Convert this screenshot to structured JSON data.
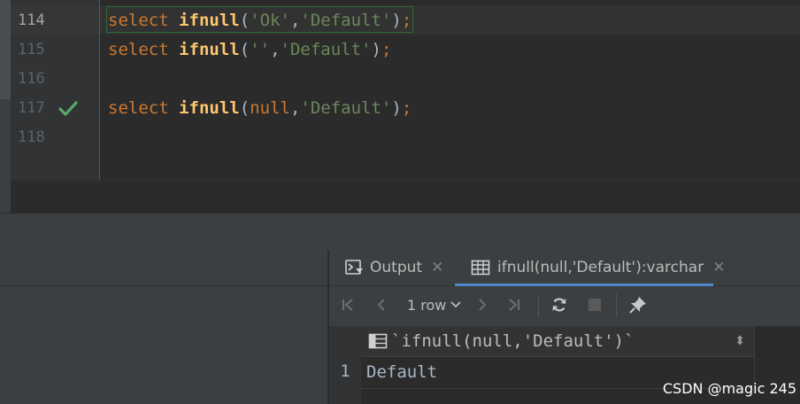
{
  "editor": {
    "lines": [
      {
        "number": "114",
        "keyword": "select",
        "func": "ifnull",
        "args": [
          "'Ok'",
          "'Default'"
        ]
      },
      {
        "number": "115",
        "keyword": "select",
        "func": "ifnull",
        "args": [
          "''",
          "'Default'"
        ]
      },
      {
        "number": "116"
      },
      {
        "number": "117",
        "keyword": "select",
        "func": "ifnull",
        "args": [
          "null",
          "'Default'"
        ]
      },
      {
        "number": "118"
      }
    ],
    "run_status_icon": "checkmark-icon",
    "colors": {
      "keyword": "#cc7832",
      "function": "#ffc66d",
      "string": "#6a8759",
      "success": "#59a869"
    }
  },
  "results": {
    "tabs": [
      {
        "label": "Output",
        "icon": "console-output-icon"
      },
      {
        "label": "ifnull(null,'Default'):varchar",
        "icon": "table-icon"
      }
    ],
    "toolbar": {
      "rows_label": "1 row",
      "icons": [
        "first-page-icon",
        "prev-page-icon",
        "next-page-icon",
        "last-page-icon",
        "refresh-icon",
        "stop-icon",
        "pin-icon"
      ]
    },
    "grid": {
      "column_header": "`ifnull(null,'Default')`",
      "rows": [
        {
          "row_number": "1",
          "value": "Default"
        }
      ]
    }
  },
  "watermark": "CSDN @magic 245"
}
